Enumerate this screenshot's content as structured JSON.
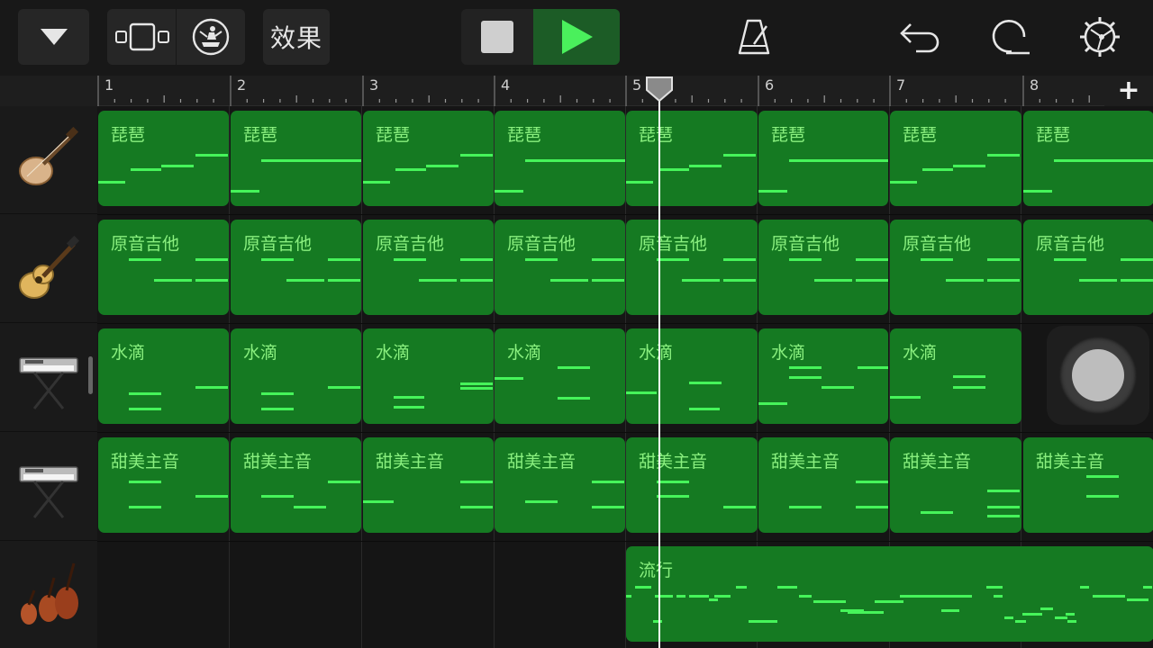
{
  "toolbar": {
    "effects_label": "效果"
  },
  "ruler": {
    "bars": [
      "1",
      "2",
      "3",
      "4",
      "5",
      "6",
      "7",
      "8"
    ],
    "add_label": "+"
  },
  "tracks": [
    {
      "name": "琵琶",
      "icon": "pipa-icon"
    },
    {
      "name": "原音吉他",
      "icon": "acoustic-guitar-icon"
    },
    {
      "name": "水滴",
      "icon": "keyboard-icon"
    },
    {
      "name": "甜美主音",
      "icon": "keyboard-icon"
    },
    {
      "name": "流行",
      "icon": "strings-icon"
    }
  ],
  "regions": {
    "pipa": [
      "琵琶",
      "琵琶",
      "琵琶",
      "琵琶",
      "琵琶",
      "琵琶",
      "琵琶",
      "琵琶"
    ],
    "guitar": [
      "原音吉他",
      "原音吉他",
      "原音吉他",
      "原音吉他",
      "原音吉他",
      "原音吉他",
      "原音吉他",
      "原音吉他"
    ],
    "drops": [
      "水滴",
      "水滴",
      "水滴",
      "水滴",
      "水滴",
      "水滴",
      "水滴"
    ],
    "lead": [
      "甜美主音",
      "甜美主音",
      "甜美主音",
      "甜美主音",
      "甜美主音",
      "甜美主音",
      "甜美主音",
      "甜美主音"
    ],
    "strings": [
      "流行"
    ]
  },
  "playhead_bar": 5.25,
  "colors": {
    "region_green": "#157a22",
    "note_green": "#46f45a",
    "label_green": "#8af07f",
    "play_green": "#1c5c26"
  }
}
